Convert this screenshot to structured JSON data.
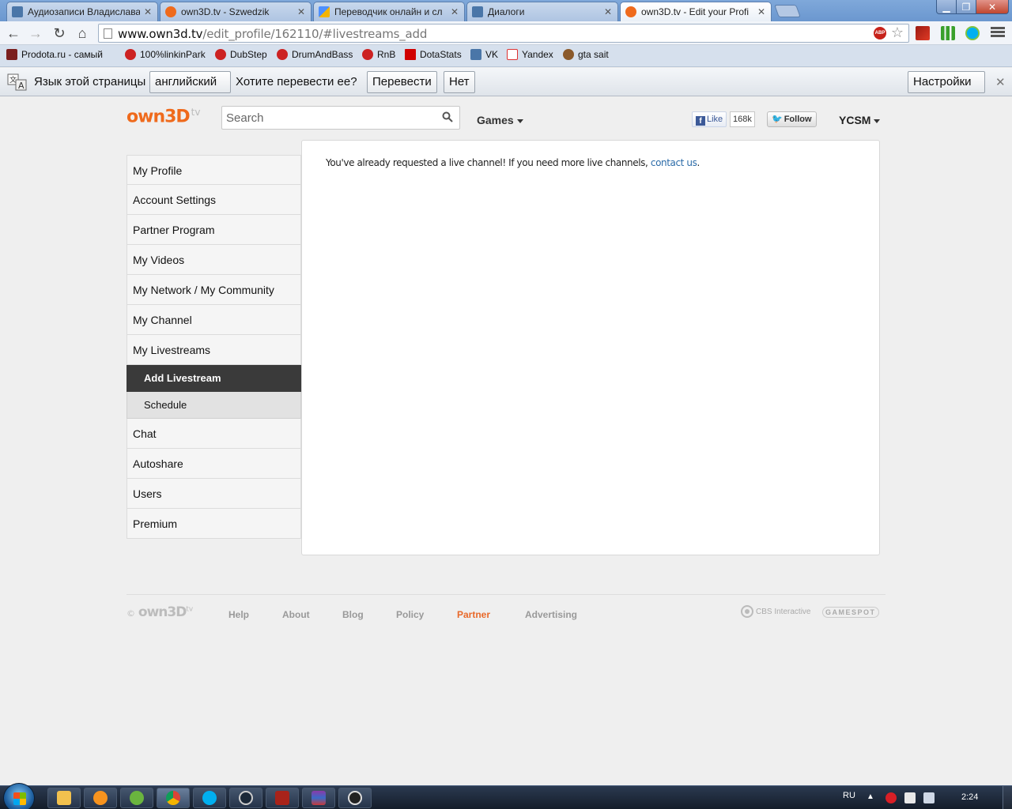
{
  "browser": {
    "tabs": [
      {
        "title": "Аудиозаписи Владислава",
        "color": "#4a76a8"
      },
      {
        "title": "own3D.tv - Szwedzik",
        "color": "#ef6a1c"
      },
      {
        "title": "Переводчик онлайн и сл",
        "color": "#4d90fe"
      },
      {
        "title": "Диалоги",
        "color": "#4a76a8"
      },
      {
        "title": "own3D.tv - Edit your Profi",
        "color": "#ef6a1c"
      }
    ],
    "url_host": "www.own3d.tv",
    "url_path": "/edit_profile/162110/#livestreams_add",
    "abp": "ABP",
    "bookmarks": [
      {
        "label": "Prodota.ru - самый",
        "color": "#7a1f1f"
      },
      {
        "label": "100%linkinPark",
        "color": "#cc2222"
      },
      {
        "label": "DubStep",
        "color": "#cc2222"
      },
      {
        "label": "DrumAndBass",
        "color": "#cc2222"
      },
      {
        "label": "RnB",
        "color": "#cc2222"
      },
      {
        "label": "DotaStats",
        "color": "#d00000"
      },
      {
        "label": "VK",
        "color": "#4a76a8"
      },
      {
        "label": "Yandex",
        "color": "#ffffff"
      },
      {
        "label": "gta sait",
        "color": "#8b5a2b"
      }
    ],
    "translate": {
      "lead": "Язык этой страницы",
      "language": "английский",
      "question": "Хотите перевести ее?",
      "translate_btn": "Перевести",
      "no_btn": "Нет",
      "settings_btn": "Настройки"
    }
  },
  "site": {
    "logo": "own3D",
    "logo_suffix": "tv",
    "search_placeholder": "Search",
    "games": "Games",
    "fb_like": "Like",
    "fb_count": "168k",
    "tw_follow": "Follow",
    "user": "YCSM",
    "sidebar": [
      "My Profile",
      "Account Settings",
      "Partner Program",
      "My Videos",
      "My Network / My Community",
      "My Channel",
      "My Livestreams"
    ],
    "sidebar_sub": [
      "Add Livestream",
      "Schedule"
    ],
    "sidebar_after": [
      "Chat",
      "Autoshare",
      "Users",
      "Premium"
    ],
    "message": "You've already requested a live channel! If you need more live channels,",
    "message_link": "contact us",
    "message_end": ".",
    "footer": {
      "copy": "©",
      "logo": "own3D",
      "logo_suffix": "tv",
      "links": [
        "Help",
        "About",
        "Blog",
        "Policy",
        "Partner",
        "Advertising"
      ],
      "cbs": "CBS Interactive",
      "gamespot": "GAMESPOT"
    }
  },
  "taskbar": {
    "lang": "RU",
    "clock": "2:24"
  }
}
